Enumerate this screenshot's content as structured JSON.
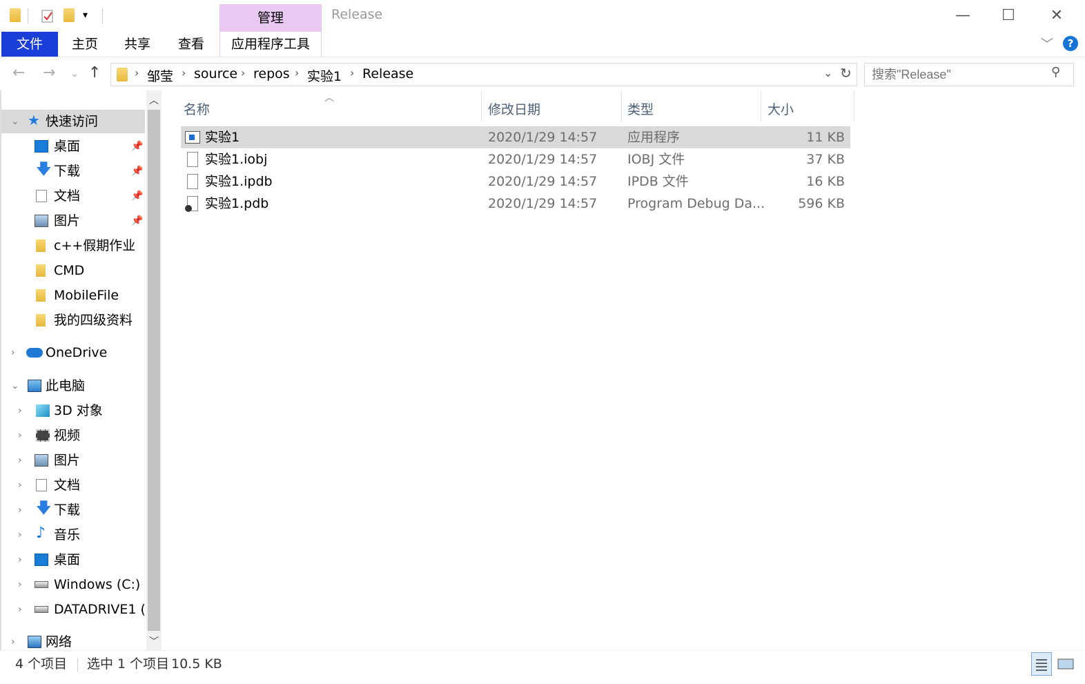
{
  "titlebar": {
    "title": "Release",
    "manage_tab": "管理",
    "minimize": "—",
    "maximize": "☐",
    "close": "✕"
  },
  "ribbon": {
    "tabs": [
      "文件",
      "主页",
      "共享",
      "查看",
      "应用程序工具"
    ],
    "help": "?"
  },
  "navbar": {
    "breadcrumb": [
      "邹莹",
      "source",
      "repos",
      "实验1",
      "Release"
    ],
    "search_placeholder": "搜索\"Release\""
  },
  "sidebar": {
    "quick_access": "快速访问",
    "quick_items": [
      {
        "label": "桌面",
        "icon": "desktop-icon",
        "pinned": true
      },
      {
        "label": "下载",
        "icon": "download-icon",
        "pinned": true
      },
      {
        "label": "文档",
        "icon": "document-icon",
        "pinned": true
      },
      {
        "label": "图片",
        "icon": "picture-icon",
        "pinned": true
      },
      {
        "label": "c++假期作业",
        "icon": "folder-icon",
        "pinned": false
      },
      {
        "label": "CMD",
        "icon": "folder-icon",
        "pinned": false
      },
      {
        "label": "MobileFile",
        "icon": "folder-icon",
        "pinned": false
      },
      {
        "label": "我的四级资料",
        "icon": "folder-icon",
        "pinned": false
      }
    ],
    "onedrive": "OneDrive",
    "this_pc": "此电脑",
    "pc_items": [
      {
        "label": "3D 对象",
        "icon": "cube-icon"
      },
      {
        "label": "视频",
        "icon": "video-icon"
      },
      {
        "label": "图片",
        "icon": "picture-icon"
      },
      {
        "label": "文档",
        "icon": "document-icon"
      },
      {
        "label": "下载",
        "icon": "download-icon"
      },
      {
        "label": "音乐",
        "icon": "music-icon"
      },
      {
        "label": "桌面",
        "icon": "desktop-icon"
      },
      {
        "label": "Windows  (C:)",
        "icon": "drive-c-icon"
      },
      {
        "label": "DATADRIVE1 (D",
        "icon": "drive-icon"
      }
    ],
    "network": "网络"
  },
  "columns": {
    "name": "名称",
    "modified": "修改日期",
    "type": "类型",
    "size": "大小"
  },
  "files": [
    {
      "name": "实验1",
      "modified": "2020/1/29 14:57",
      "type": "应用程序",
      "size": "11 KB",
      "icon": "exe-icon",
      "selected": true
    },
    {
      "name": "实验1.iobj",
      "modified": "2020/1/29 14:57",
      "type": "IOBJ 文件",
      "size": "37 KB",
      "icon": "file-icon",
      "selected": false
    },
    {
      "name": "实验1.ipdb",
      "modified": "2020/1/29 14:57",
      "type": "IPDB 文件",
      "size": "16 KB",
      "icon": "file-icon",
      "selected": false
    },
    {
      "name": "实验1.pdb",
      "modified": "2020/1/29 14:57",
      "type": "Program Debug Da...",
      "size": "596 KB",
      "icon": "pdb-icon",
      "selected": false
    }
  ],
  "status": {
    "count": "4 个项目",
    "selection": "选中 1 个项目",
    "selection_size": "10.5 KB"
  },
  "colors": {
    "file_tab_bg": "#1a3fd9",
    "manage_tab_bg": "#e9c8f2",
    "selected_row": "#d9d9d9",
    "quick_access_bg": "#d9d9d9"
  }
}
